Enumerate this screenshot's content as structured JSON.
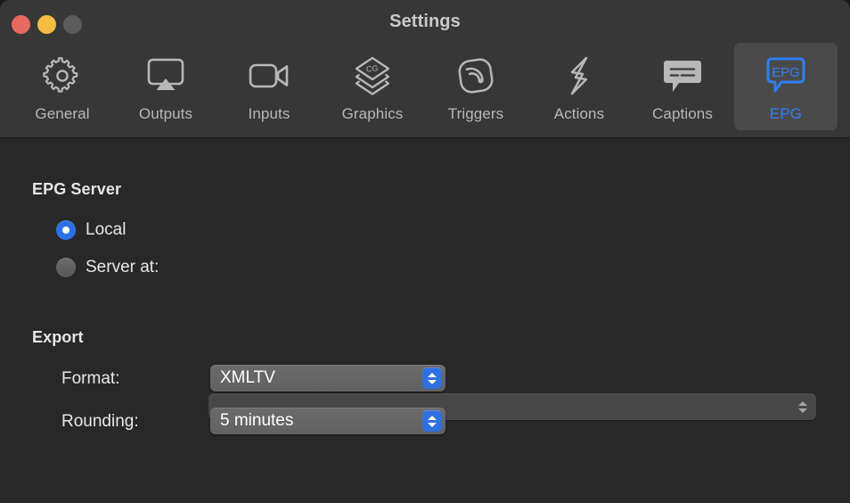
{
  "window": {
    "title": "Settings",
    "traffic_lights": [
      {
        "name": "close",
        "color": "#e8695e"
      },
      {
        "name": "minimize",
        "color": "#f2bd41"
      },
      {
        "name": "zoom",
        "color": "#5c5c5c"
      }
    ]
  },
  "toolbar": {
    "tabs": [
      {
        "label": "General",
        "icon": "gear-icon",
        "selected": false
      },
      {
        "label": "Outputs",
        "icon": "airplay-icon",
        "selected": false
      },
      {
        "label": "Inputs",
        "icon": "video-camera-icon",
        "selected": false
      },
      {
        "label": "Graphics",
        "icon": "layers-cg-icon",
        "selected": false
      },
      {
        "label": "Triggers",
        "icon": "signal-waves-icon",
        "selected": false
      },
      {
        "label": "Actions",
        "icon": "lightning-bolt-icon",
        "selected": false
      },
      {
        "label": "Captions",
        "icon": "caption-bubble-icon",
        "selected": false
      },
      {
        "label": "EPG",
        "icon": "epg-bubble-icon",
        "selected": true
      }
    ],
    "selected_tab": "EPG",
    "accent_color": "#2f7ff5"
  },
  "content": {
    "epg_server": {
      "section_title": "EPG Server",
      "options": [
        {
          "label": "Local",
          "selected": true
        },
        {
          "label": "Server at:",
          "selected": false
        }
      ],
      "server_field": {
        "value": "",
        "placeholder": ""
      }
    },
    "export": {
      "section_title": "Export",
      "fields": [
        {
          "label": "Format:",
          "value": "XMLTV"
        },
        {
          "label": "Rounding:",
          "value": "5 minutes"
        }
      ]
    }
  },
  "colors": {
    "toolbar_bg": "#373737",
    "content_bg": "#282828",
    "selected_tab_bg": "#4a4a4a",
    "accent_blue": "#2b72e8",
    "popup_blue": "#2f6fe0"
  }
}
